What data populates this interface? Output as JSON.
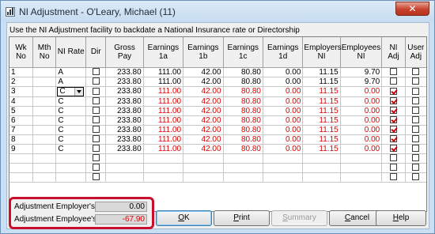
{
  "window": {
    "title": "NI Adjustment - O'Leary, Michael  (11)",
    "close_glyph": "✕"
  },
  "instruction": "Use the NI Adjustment facility to backdate a National Insurance rate or Directorship",
  "table": {
    "columns": [
      {
        "key": "wk",
        "label": "Wk No"
      },
      {
        "key": "mth",
        "label": "Mth No"
      },
      {
        "key": "rate",
        "label": "NI Rate"
      },
      {
        "key": "dir",
        "label": "Dir"
      },
      {
        "key": "gross",
        "label": "Gross Pay"
      },
      {
        "key": "e1a",
        "label": "Earnings 1a"
      },
      {
        "key": "e1b",
        "label": "Earnings 1b"
      },
      {
        "key": "e1c",
        "label": "Earnings 1c"
      },
      {
        "key": "e1d",
        "label": "Earnings 1d"
      },
      {
        "key": "er",
        "label": "Employers NI"
      },
      {
        "key": "ee",
        "label": "Employees NI"
      },
      {
        "key": "niadj",
        "label": "NI Adj"
      },
      {
        "key": "useradj",
        "label": "User Adj"
      }
    ],
    "rows": [
      {
        "wk": "1",
        "mth": "",
        "rate": "A",
        "gross": "233.80",
        "e1a": "111.00",
        "e1b": "42.00",
        "e1c": "80.80",
        "e1d": "0.00",
        "er": "11.15",
        "ee": "9.70",
        "ni_adj": false,
        "red": false
      },
      {
        "wk": "2",
        "mth": "",
        "rate": "A",
        "gross": "233.80",
        "e1a": "111.00",
        "e1b": "42.00",
        "e1c": "80.80",
        "e1d": "0.00",
        "er": "11.15",
        "ee": "9.70",
        "ni_adj": false,
        "red": false
      },
      {
        "wk": "3",
        "mth": "",
        "rate": "C",
        "gross": "233.80",
        "e1a": "111.00",
        "e1b": "42.00",
        "e1c": "80.80",
        "e1d": "0.00",
        "er": "11.15",
        "ee": "0.00",
        "ni_adj": true,
        "red": true,
        "dropdown": true
      },
      {
        "wk": "4",
        "mth": "",
        "rate": "C",
        "gross": "233.80",
        "e1a": "111.00",
        "e1b": "42.00",
        "e1c": "80.80",
        "e1d": "0.00",
        "er": "11.15",
        "ee": "0.00",
        "ni_adj": true,
        "red": true
      },
      {
        "wk": "5",
        "mth": "",
        "rate": "C",
        "gross": "233.80",
        "e1a": "111.00",
        "e1b": "42.00",
        "e1c": "80.80",
        "e1d": "0.00",
        "er": "11.15",
        "ee": "0.00",
        "ni_adj": true,
        "red": true
      },
      {
        "wk": "6",
        "mth": "",
        "rate": "C",
        "gross": "233.80",
        "e1a": "111.00",
        "e1b": "42.00",
        "e1c": "80.80",
        "e1d": "0.00",
        "er": "11.15",
        "ee": "0.00",
        "ni_adj": true,
        "red": true
      },
      {
        "wk": "7",
        "mth": "",
        "rate": "C",
        "gross": "233.80",
        "e1a": "111.00",
        "e1b": "42.00",
        "e1c": "80.80",
        "e1d": "0.00",
        "er": "11.15",
        "ee": "0.00",
        "ni_adj": true,
        "red": true
      },
      {
        "wk": "8",
        "mth": "",
        "rate": "C",
        "gross": "233.80",
        "e1a": "111.00",
        "e1b": "42.00",
        "e1c": "80.80",
        "e1d": "0.00",
        "er": "11.15",
        "ee": "0.00",
        "ni_adj": true,
        "red": true
      },
      {
        "wk": "9",
        "mth": "",
        "rate": "C",
        "gross": "233.80",
        "e1a": "111.00",
        "e1b": "42.00",
        "e1c": "80.80",
        "e1d": "0.00",
        "er": "11.15",
        "ee": "0.00",
        "ni_adj": true,
        "red": true
      }
    ],
    "empty_rows": 3,
    "red_color": "#e00000"
  },
  "adjustment": {
    "employer_label": "Adjustment Employer's:",
    "employer_value": "0.00",
    "employee_label": "Adjustment Employee's:",
    "employee_value": "-67.90",
    "employee_value_color": "#e00000",
    "highlight_color": "#c8102e"
  },
  "buttons": {
    "ok": {
      "label": "OK",
      "accel": "O",
      "rest": "K"
    },
    "print": {
      "label": "Print",
      "accel": "P",
      "rest": "rint"
    },
    "summary": {
      "label": "Summary",
      "accel": "S",
      "rest": "ummary"
    },
    "cancel": {
      "label": "Cancel",
      "accel": "C",
      "rest": "ancel"
    },
    "help": {
      "label": "Help",
      "accel": "H",
      "rest": "elp"
    }
  }
}
